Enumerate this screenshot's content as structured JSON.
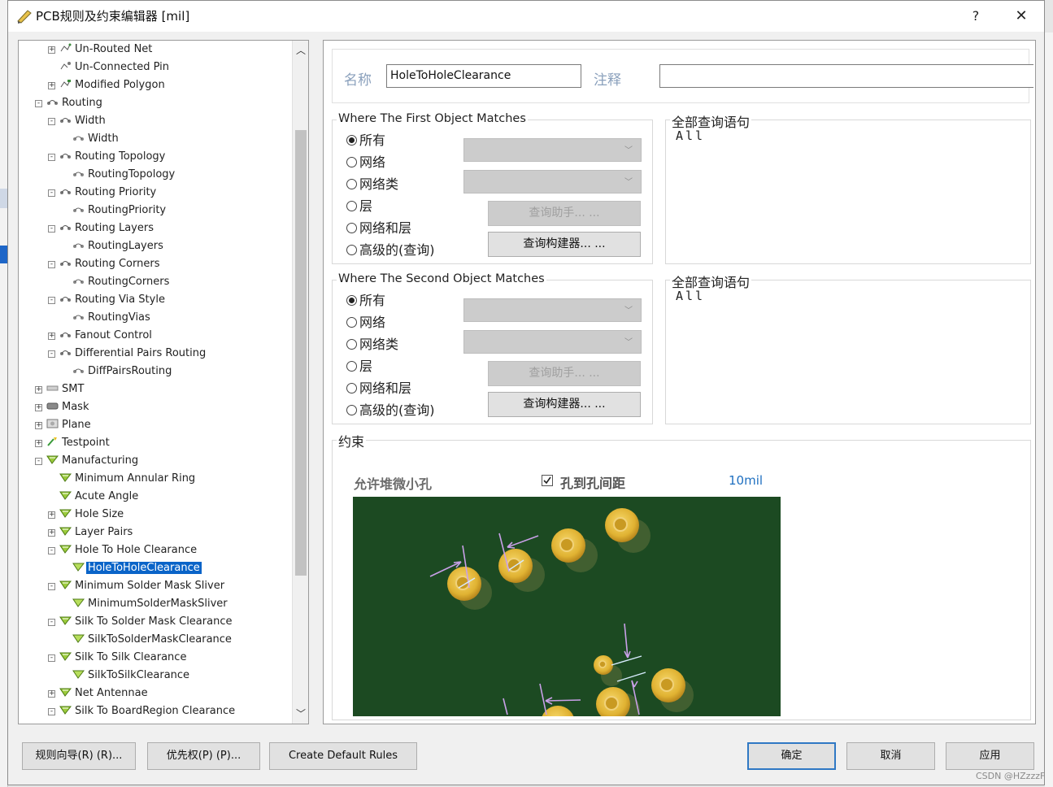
{
  "window": {
    "title": "PCB规则及约束编辑器 [mil]",
    "help_glyph": "?",
    "close_glyph": "✕"
  },
  "tree": {
    "items": [
      {
        "label": "Un-Routed Net",
        "icon": "routed-net-icon"
      },
      {
        "label": "Un-Connected Pin",
        "icon": "unconnected-pin-icon"
      },
      {
        "label": "Modified Polygon",
        "icon": "polygon-icon"
      },
      {
        "label": "Routing",
        "icon": "routing-icon"
      },
      {
        "label": "Width",
        "icon": "routing-icon"
      },
      {
        "label": "Width",
        "icon": "routing-rule-icon"
      },
      {
        "label": "Routing Topology",
        "icon": "routing-icon"
      },
      {
        "label": "RoutingTopology",
        "icon": "routing-rule-icon"
      },
      {
        "label": "Routing Priority",
        "icon": "routing-icon"
      },
      {
        "label": "RoutingPriority",
        "icon": "routing-rule-icon"
      },
      {
        "label": "Routing Layers",
        "icon": "routing-icon"
      },
      {
        "label": "RoutingLayers",
        "icon": "routing-rule-icon"
      },
      {
        "label": "Routing Corners",
        "icon": "routing-icon"
      },
      {
        "label": "RoutingCorners",
        "icon": "routing-rule-icon"
      },
      {
        "label": "Routing Via Style",
        "icon": "routing-icon"
      },
      {
        "label": "RoutingVias",
        "icon": "routing-rule-icon"
      },
      {
        "label": "Fanout Control",
        "icon": "routing-icon"
      },
      {
        "label": "Differential Pairs Routing",
        "icon": "routing-icon"
      },
      {
        "label": "DiffPairsRouting",
        "icon": "routing-rule-icon"
      },
      {
        "label": "SMT",
        "icon": "smt-icon"
      },
      {
        "label": "Mask",
        "icon": "mask-icon"
      },
      {
        "label": "Plane",
        "icon": "plane-icon"
      },
      {
        "label": "Testpoint",
        "icon": "testpoint-icon"
      },
      {
        "label": "Manufacturing",
        "icon": "manufacturing-icon"
      },
      {
        "label": "Minimum Annular Ring",
        "icon": "manufacturing-icon"
      },
      {
        "label": "Acute Angle",
        "icon": "manufacturing-icon"
      },
      {
        "label": "Hole Size",
        "icon": "manufacturing-icon"
      },
      {
        "label": "Layer Pairs",
        "icon": "manufacturing-icon"
      },
      {
        "label": "Hole To Hole Clearance",
        "icon": "manufacturing-icon"
      },
      {
        "label": "HoleToHoleClearance",
        "icon": "manufacturing-rule-icon"
      },
      {
        "label": "Minimum Solder Mask Sliver",
        "icon": "manufacturing-icon"
      },
      {
        "label": "MinimumSolderMaskSliver",
        "icon": "manufacturing-rule-icon"
      },
      {
        "label": "Silk To Solder Mask Clearance",
        "icon": "manufacturing-icon"
      },
      {
        "label": "SilkToSolderMaskClearance",
        "icon": "manufacturing-rule-icon"
      },
      {
        "label": "Silk To Silk Clearance",
        "icon": "manufacturing-icon"
      },
      {
        "label": "SilkToSilkClearance",
        "icon": "manufacturing-rule-icon"
      },
      {
        "label": "Net Antennae",
        "icon": "manufacturing-icon"
      },
      {
        "label": "Silk To BoardRegion Clearance",
        "icon": "manufacturing-icon"
      }
    ],
    "selected_label": "HoleToHoleClearance",
    "scroll_up_glyph": "︿",
    "scroll_down_glyph": "﹀"
  },
  "rule": {
    "name_label": "名称",
    "name_value": "HoleToHoleClearance",
    "comment_label": "注释",
    "comment_value": ""
  },
  "first_match": {
    "title": "Where The First Object Matches",
    "options": [
      "所有",
      "网络",
      "网络类",
      "层",
      "网络和层",
      "高级的(查询)"
    ],
    "selected": "所有",
    "query_helper": "查询助手... ...",
    "query_builder": "查询构建器... ...",
    "query_title": "全部查询语句",
    "query_text": "All"
  },
  "second_match": {
    "title": "Where The Second Object Matches",
    "options": [
      "所有",
      "网络",
      "网络类",
      "层",
      "网络和层",
      "高级的(查询)"
    ],
    "selected": "所有",
    "query_helper": "查询助手... ...",
    "query_builder": "查询构建器... ...",
    "query_title": "全部查询语句",
    "query_text": "All"
  },
  "constraints": {
    "title": "约束",
    "allow_stacked_label": "允许堆微小孔",
    "hole_to_hole_label": "孔到孔间距",
    "hole_to_hole_checked": true,
    "clearance_value": "10mil"
  },
  "footer": {
    "rule_wizard": "规则向导(R) (R)...",
    "priority": "优先权(P) (P)...",
    "create_default": "Create Default Rules",
    "ok": "确定",
    "cancel": "取消",
    "apply": "应用",
    "watermark": "CSDN @HZzzzF"
  },
  "colors": {
    "selection": "#0a64c8",
    "pcb_board": "#1c4a22",
    "pad_gold": "#e0b232",
    "clearance_value": "#1e6fc0",
    "label_blue_gray": "#8aa0bc"
  }
}
